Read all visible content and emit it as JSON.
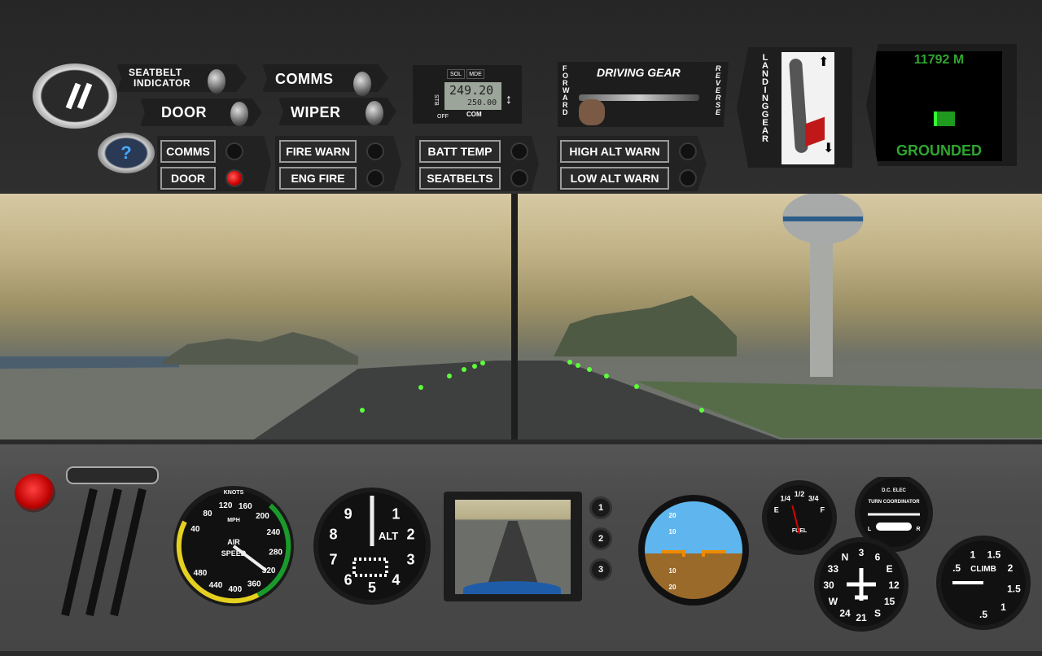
{
  "top_panel": {
    "pause_icon": "pause-icon",
    "help_label": "?",
    "toggles": [
      {
        "label": "SEATBELT\nINDICATOR",
        "l1": "SEATBELT",
        "l2": "INDICATOR"
      },
      {
        "label": "DOOR"
      },
      {
        "label": "COMMS"
      },
      {
        "label": "WIPER"
      }
    ],
    "radio": {
      "sol": "SOL",
      "mde": "MDE",
      "freq_active": "249.20",
      "freq_standby": "250.00",
      "stb": "STB",
      "off": "OFF",
      "com": "COM",
      "swap_icon": "swap-arrows-icon"
    },
    "driving_gear": {
      "title": "DRIVING GEAR",
      "forward": "FORWARD",
      "reverse": "REVERSE"
    },
    "landing_gear": {
      "label": "LANDING GEAR",
      "state": "down"
    },
    "display": {
      "altitude": "11792 M",
      "status": "GROUNDED",
      "color": "#2fa52f"
    },
    "warnings": [
      {
        "label": "COMMS",
        "lit": false
      },
      {
        "label": "DOOR",
        "lit": true
      },
      {
        "label": "FIRE WARN",
        "lit": false
      },
      {
        "label": "ENG FIRE",
        "lit": false
      },
      {
        "label": "BATT TEMP",
        "lit": false
      },
      {
        "label": "SEATBELTS",
        "lit": false
      },
      {
        "label": "HIGH ALT WARN",
        "lit": false
      },
      {
        "label": "LOW ALT WARN",
        "lit": false
      }
    ]
  },
  "dashboard": {
    "airspeed": {
      "top": "KNOTS",
      "ticks": [
        "40",
        "80",
        "120",
        "160",
        "200",
        "240",
        "280",
        "320",
        "360",
        "400",
        "440",
        "480"
      ],
      "center1": "AIR",
      "center2": "SPEED",
      "mph": "MPH"
    },
    "altimeter": {
      "label": "ALT",
      "ticks": [
        "0",
        "1",
        "2",
        "3",
        "4",
        "5",
        "6",
        "7",
        "8",
        "9"
      ]
    },
    "camera_buttons": [
      "1",
      "2",
      "3"
    ],
    "attitude": {
      "marks": [
        "20",
        "10",
        "10",
        "20"
      ]
    },
    "fuel": {
      "ticks": [
        "E",
        "1/4",
        "1/2",
        "3/4",
        "F"
      ],
      "label": "FUEL",
      "level": 0.4
    },
    "turn": {
      "top": "D.C. ELEC",
      "label": "TURN COORDINATOR",
      "l": "L",
      "r": "R"
    },
    "heading": {
      "ticks": [
        "N",
        "3",
        "6",
        "E",
        "12",
        "15",
        "S",
        "21",
        "24",
        "W",
        "30",
        "33"
      ]
    },
    "vsi": {
      "label": "CLIMB",
      "ticks": [
        ".5",
        "1",
        "1.5",
        "2",
        "1.5",
        "1",
        ".5"
      ]
    }
  }
}
